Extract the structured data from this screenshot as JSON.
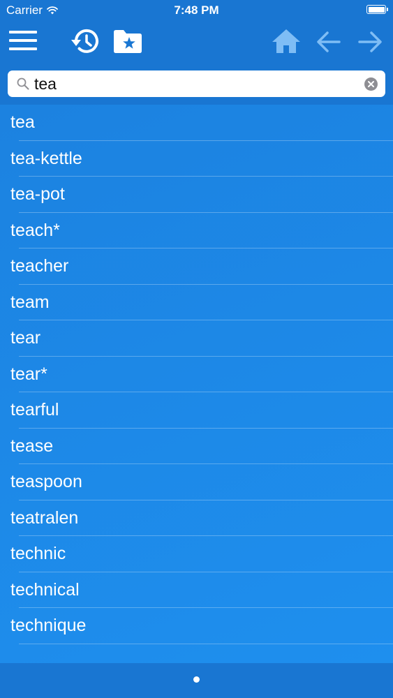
{
  "status_bar": {
    "carrier": "Carrier",
    "time": "7:48 PM",
    "battery_level": 1.0
  },
  "toolbar": {
    "left_icons": [
      "menu-icon",
      "history-icon",
      "favorites-folder-icon"
    ],
    "right_icons": [
      "home-icon",
      "back-arrow-icon",
      "forward-arrow-icon"
    ]
  },
  "search": {
    "value": "tea",
    "placeholder": ""
  },
  "results": [
    {
      "label": "tea"
    },
    {
      "label": "tea-kettle"
    },
    {
      "label": "tea-pot"
    },
    {
      "label": "teach*"
    },
    {
      "label": "teacher"
    },
    {
      "label": "team"
    },
    {
      "label": "tear"
    },
    {
      "label": "tear*"
    },
    {
      "label": "tearful"
    },
    {
      "label": "tease"
    },
    {
      "label": "teaspoon"
    },
    {
      "label": "teatralen"
    },
    {
      "label": "technic"
    },
    {
      "label": "technical"
    },
    {
      "label": "technique"
    }
  ],
  "pagination": {
    "pages": 1,
    "current": 1
  },
  "colors": {
    "header": "#1976d2",
    "list_background": "#1e88e5",
    "text": "#ffffff",
    "inactive_icon": "#7fbdf5"
  }
}
